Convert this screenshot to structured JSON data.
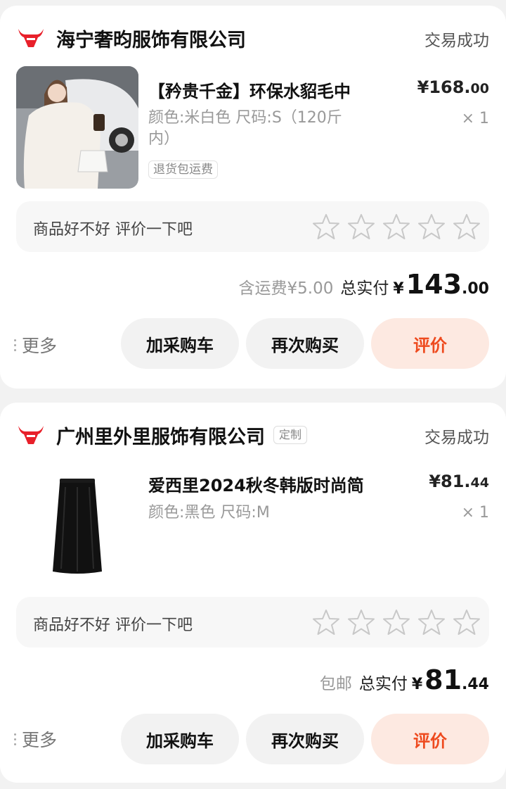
{
  "orders": [
    {
      "shop_name": "海宁奢昀服饰有限公司",
      "shop_tag": "",
      "status": "交易成功",
      "product": {
        "title": "【矜贵千金】环保水貂毛中",
        "spec_line1": "颜色:米白色 尺码:S（120斤",
        "spec_line2": "内）",
        "badge": "退货包运费",
        "price_main": "¥168.",
        "price_dec": "00",
        "qty": "× 1"
      },
      "review_prompt": "商品好不好 评价一下吧",
      "shipping": "含运费¥5.00",
      "total_label": "总实付",
      "total_currency": "¥",
      "total_int": "143",
      "total_dec": ".00",
      "more": "更多",
      "buttons": {
        "cart": "加采购车",
        "rebuy": "再次购买",
        "review": "评价"
      }
    },
    {
      "shop_name": "广州里外里服饰有限公司",
      "shop_tag": "定制",
      "status": "交易成功",
      "product": {
        "title": "爱西里2024秋冬韩版时尚简",
        "spec_line1": "颜色:黑色 尺码:M",
        "spec_line2": "",
        "badge": "",
        "price_main": "¥81.",
        "price_dec": "44",
        "qty": "× 1"
      },
      "review_prompt": "商品好不好 评价一下吧",
      "shipping": "包邮",
      "total_label": "总实付",
      "total_currency": "¥",
      "total_int": "81",
      "total_dec": ".44",
      "more": "更多",
      "buttons": {
        "cart": "加采购车",
        "rebuy": "再次购买",
        "review": "评价"
      }
    }
  ],
  "colors": {
    "accent": "#ee4a1e",
    "accent_bg": "#fde9e1",
    "logo_red": "#e8202a"
  },
  "icons": {
    "shop_logo": "red-bull-head-logo",
    "star": "star-outline-icon",
    "more": "vertical-dots-icon"
  }
}
